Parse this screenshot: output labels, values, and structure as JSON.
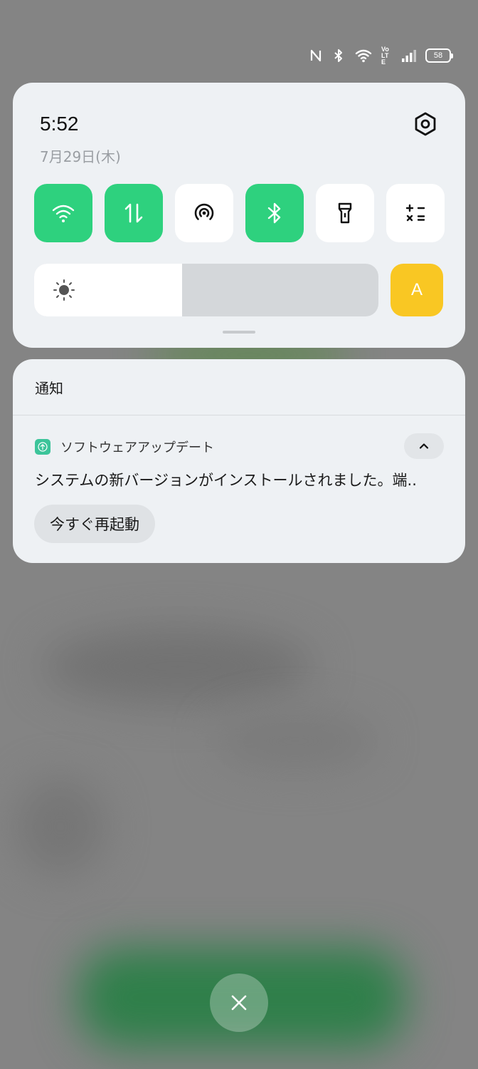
{
  "status_bar": {
    "icons": [
      "nfc-icon",
      "bluetooth-icon",
      "wifi-icon",
      "volte-icon",
      "signal-icon"
    ],
    "volte_text": "Vo LTE",
    "battery_level": "58"
  },
  "quick_settings": {
    "time": "5:52",
    "date": "7月29日(木)",
    "tiles": [
      {
        "name": "wifi",
        "icon": "wifi-icon",
        "active": true
      },
      {
        "name": "mobile-data",
        "icon": "data-arrows-icon",
        "active": true
      },
      {
        "name": "hotspot",
        "icon": "hotspot-icon",
        "active": false
      },
      {
        "name": "bluetooth",
        "icon": "bluetooth-icon",
        "active": true
      },
      {
        "name": "flashlight",
        "icon": "flashlight-icon",
        "active": false
      },
      {
        "name": "calculator",
        "icon": "calculator-icon",
        "active": false
      }
    ],
    "brightness_level": 0.43,
    "auto_brightness_label": "A",
    "colors": {
      "active_tile": "#2ed17e",
      "auto_button": "#f9c723"
    }
  },
  "notifications": {
    "header": "通知",
    "items": [
      {
        "app_name": "ソフトウェアアップデート",
        "body": "システムの新バージョンがインストールされました。端..",
        "action_label": "今すぐ再起動"
      }
    ]
  }
}
